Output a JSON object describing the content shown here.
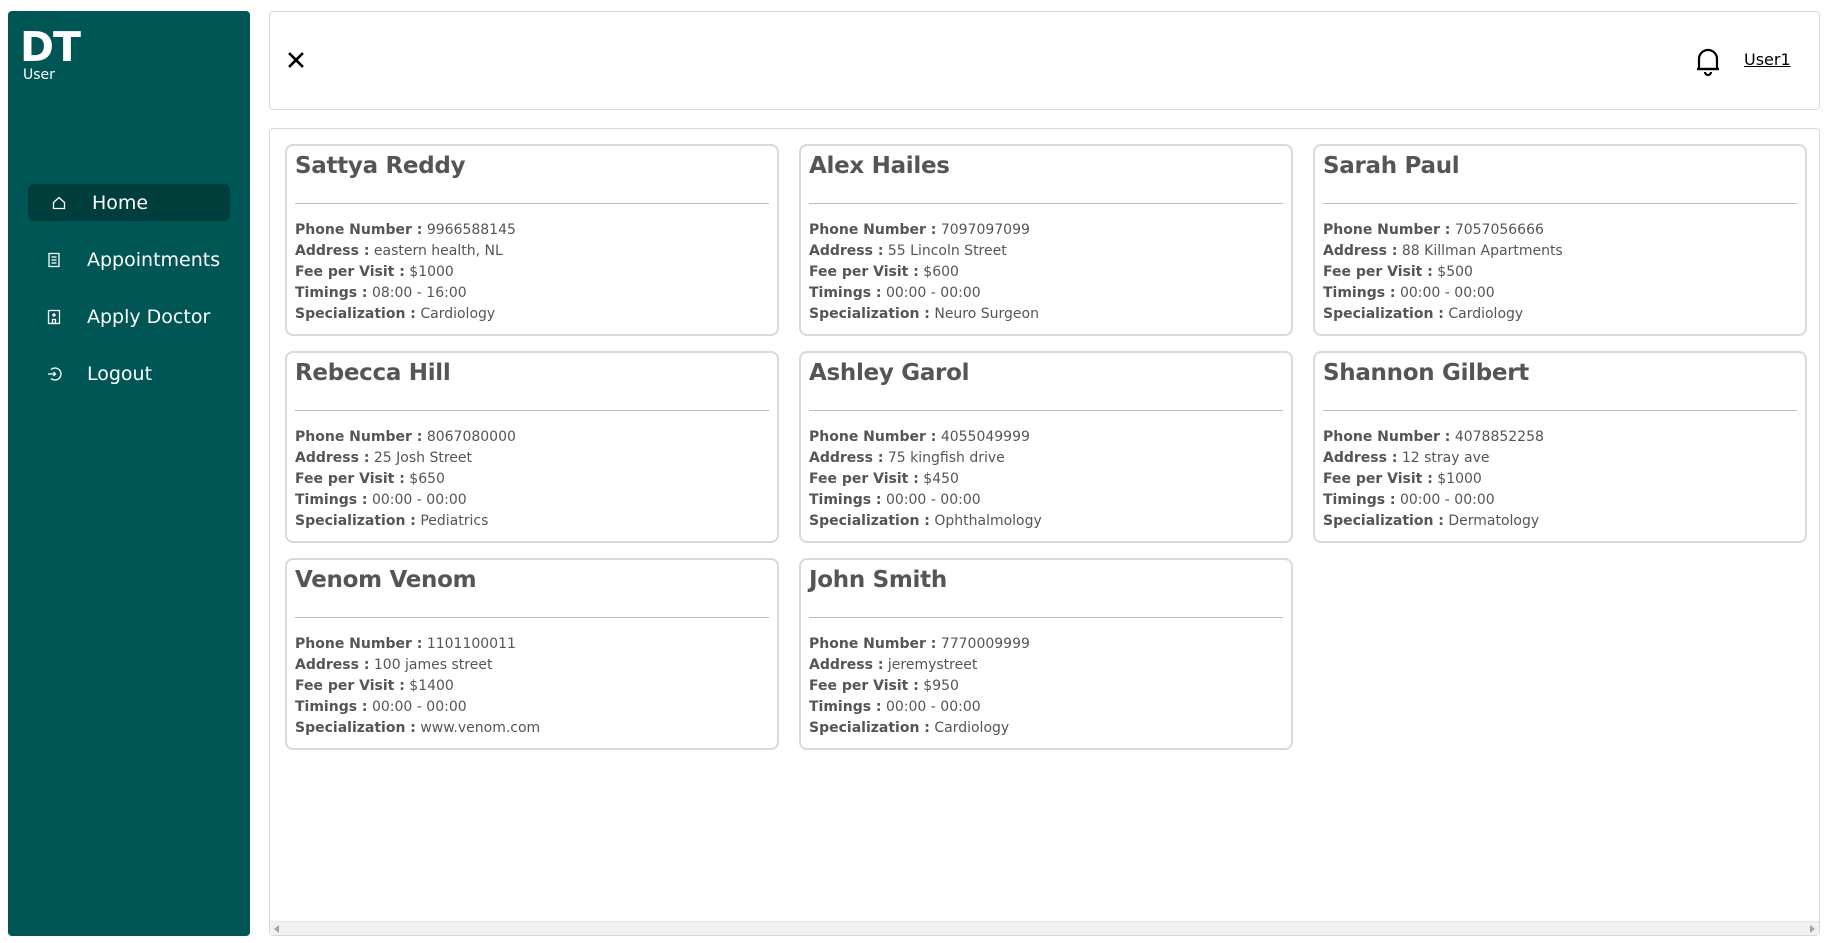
{
  "sidebar": {
    "logo": "DT",
    "role": "User",
    "items": [
      {
        "label": "Home",
        "icon": "home-icon",
        "active": true
      },
      {
        "label": "Appointments",
        "icon": "list-icon",
        "active": false
      },
      {
        "label": "Apply Doctor",
        "icon": "hospital-icon",
        "active": false
      },
      {
        "label": "Logout",
        "icon": "logout-icon",
        "active": false
      }
    ]
  },
  "header": {
    "close_icon": "close-icon",
    "bell_icon": "bell-icon",
    "user": "User1"
  },
  "labels": {
    "phone": "Phone Number :",
    "address": "Address :",
    "fee": "Fee per Visit :",
    "timings": "Timings :",
    "specialization": "Specialization :"
  },
  "doctors": [
    {
      "name": "Sattya Reddy",
      "phone": "9966588145",
      "address": "eastern health, NL",
      "fee": "$1000",
      "timings": "08:00 - 16:00",
      "specialization": "Cardiology"
    },
    {
      "name": "Alex Hailes",
      "phone": "7097097099",
      "address": "55 Lincoln Street",
      "fee": "$600",
      "timings": "00:00 - 00:00",
      "specialization": "Neuro Surgeon"
    },
    {
      "name": "Sarah Paul",
      "phone": "7057056666",
      "address": "88 Killman Apartments",
      "fee": "$500",
      "timings": "00:00 - 00:00",
      "specialization": "Cardiology"
    },
    {
      "name": "Rebecca Hill",
      "phone": "8067080000",
      "address": "25 Josh Street",
      "fee": "$650",
      "timings": "00:00 - 00:00",
      "specialization": "Pediatrics"
    },
    {
      "name": "Ashley Garol",
      "phone": "4055049999",
      "address": "75 kingfish drive",
      "fee": "$450",
      "timings": "00:00 - 00:00",
      "specialization": "Ophthalmology"
    },
    {
      "name": "Shannon Gilbert",
      "phone": "4078852258",
      "address": "12 stray ave",
      "fee": "$1000",
      "timings": "00:00 - 00:00",
      "specialization": "Dermatology"
    },
    {
      "name": "Venom Venom",
      "phone": "1101100011",
      "address": "100 james street",
      "fee": "$1400",
      "timings": "00:00 - 00:00",
      "specialization": "www.venom.com"
    },
    {
      "name": "John Smith",
      "phone": "7770009999",
      "address": "jeremystreet",
      "fee": "$950",
      "timings": "00:00 - 00:00",
      "specialization": "Cardiology"
    }
  ],
  "colors": {
    "sidebar": "#005555",
    "sidebar_active": "#003d3d",
    "border": "#d9d9d9",
    "text": "#555555"
  }
}
